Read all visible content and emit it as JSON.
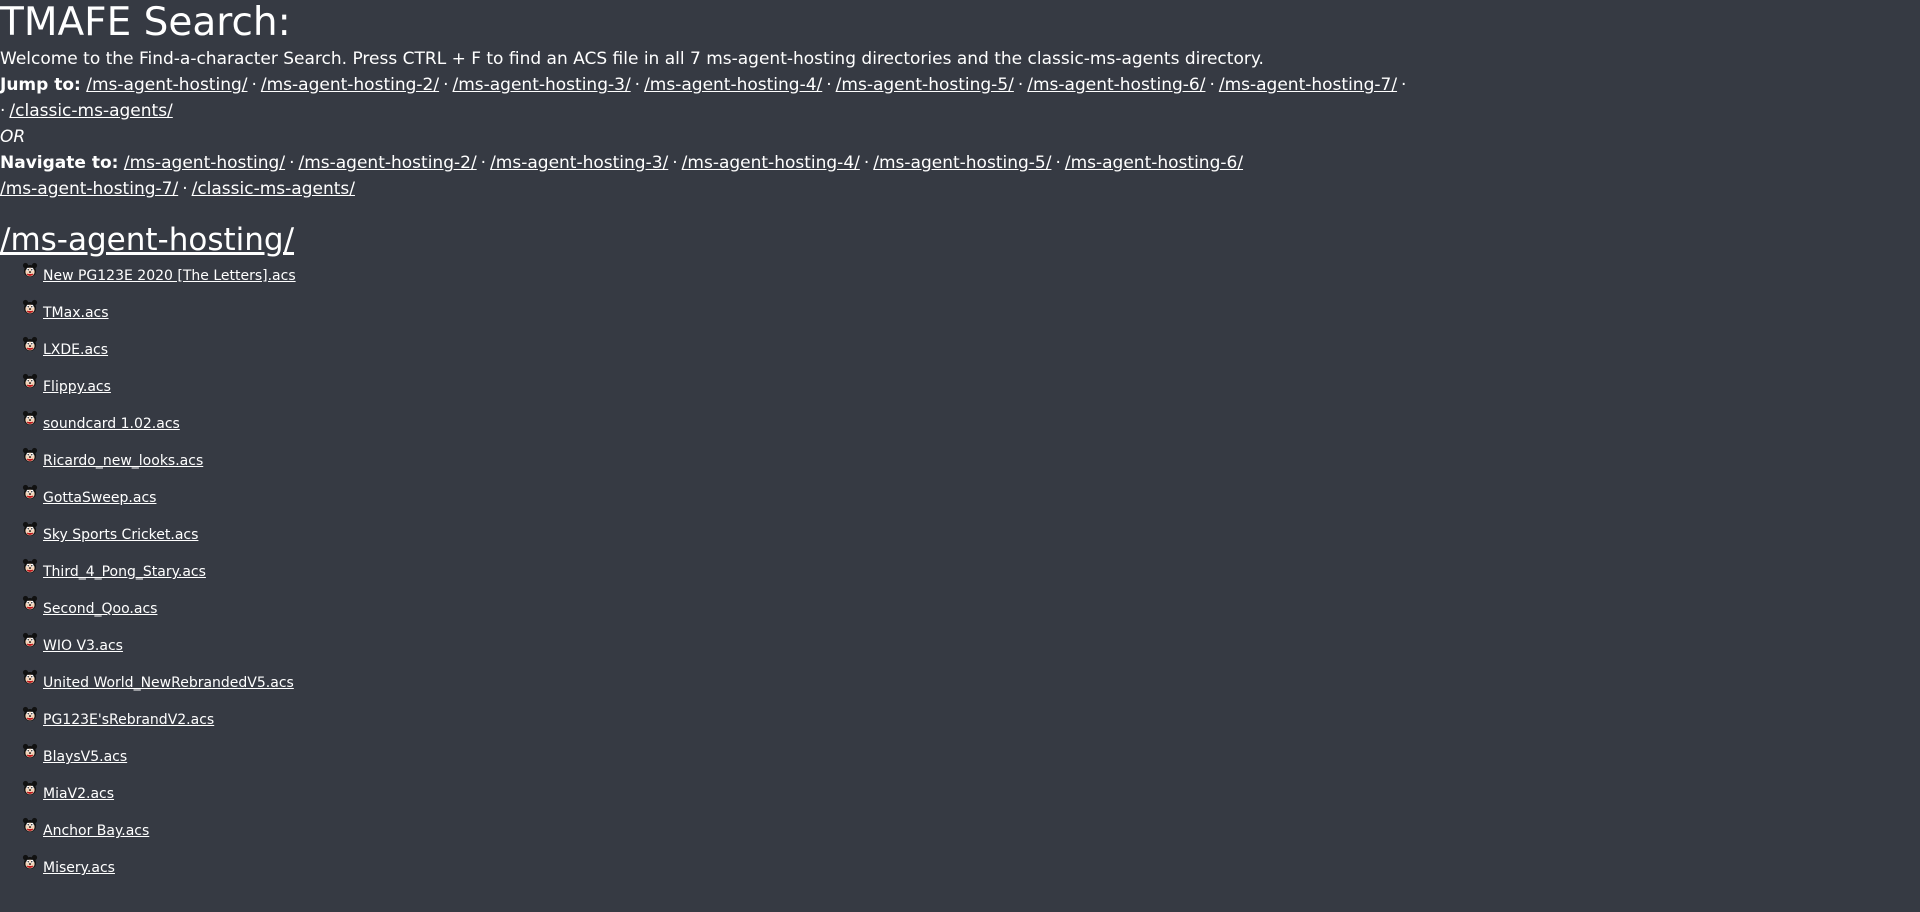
{
  "title": "TMAFE Search:",
  "intro": "Welcome to the Find-a-character Search. Press CTRL + F to find an ACS file in all 7 ms-agent-hosting directories and the classic-ms-agents directory.",
  "jump": {
    "label": "Jump to:",
    "links": [
      "/ms-agent-hosting/",
      "/ms-agent-hosting-2/",
      "/ms-agent-hosting-3/",
      "/ms-agent-hosting-4/",
      "/ms-agent-hosting-5/",
      "/ms-agent-hosting-6/",
      "/ms-agent-hosting-7/",
      "/classic-ms-agents/"
    ]
  },
  "or_text": "OR",
  "navigate": {
    "label": "Navigate to:",
    "links": [
      "/ms-agent-hosting/",
      "/ms-agent-hosting-2/",
      "/ms-agent-hosting-3/",
      "/ms-agent-hosting-4/",
      "/ms-agent-hosting-5/",
      "/ms-agent-hosting-6/",
      "/ms-agent-hosting-7/",
      "/classic-ms-agents/"
    ]
  },
  "section": {
    "heading": "/ms-agent-hosting/",
    "files": [
      "New PG123E 2020 [The Letters].acs",
      "TMax.acs",
      "LXDE.acs",
      "Flippy.acs",
      "soundcard 1.02.acs",
      "Ricardo_new_looks.acs",
      "GottaSweep.acs",
      "Sky Sports Cricket.acs",
      "Third_4_Pong_Stary.acs",
      "Second_Qoo.acs",
      "WIO V3.acs",
      "United World_NewRebrandedV5.acs",
      "PG123E'sRebrandV2.acs",
      "BlaysV5.acs",
      "MiaV2.acs",
      "Anchor Bay.acs",
      "Misery.acs"
    ]
  },
  "separator": "·",
  "icon": "agent-face-icon"
}
